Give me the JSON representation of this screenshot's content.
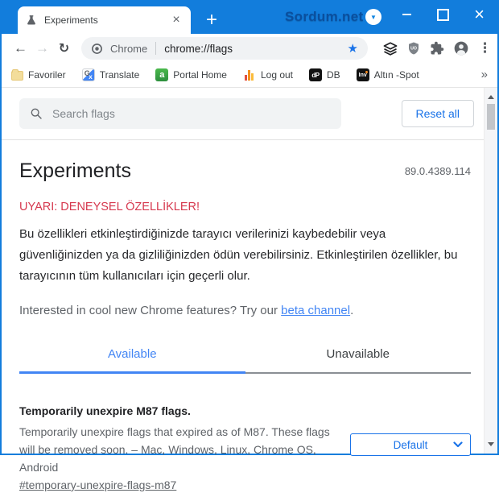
{
  "window": {
    "tab_title": "Experiments",
    "watermark": "Sordum.net"
  },
  "toolbar": {
    "site_label": "Chrome",
    "url": "chrome://flags"
  },
  "bookmarks": {
    "items": [
      {
        "label": "Favoriler",
        "icon": "folder-icon"
      },
      {
        "label": "Translate",
        "icon": "translate-icon"
      },
      {
        "label": "Portal Home",
        "icon": "portal-icon"
      },
      {
        "label": "Log out",
        "icon": "logout-bars-icon"
      },
      {
        "label": "DB",
        "icon": "db-icon"
      },
      {
        "label": "Altın -Spot",
        "icon": "investing-icon"
      }
    ]
  },
  "page": {
    "search_placeholder": "Search flags",
    "reset_button": "Reset all",
    "title": "Experiments",
    "version": "89.0.4389.114",
    "warning": "UYARI: DENEYSEL ÖZELLİKLER!",
    "intro": "Bu özellikleri etkinleştirdiğinizde tarayıcı verilerinizi kaybedebilir veya güvenliğinizden ya da gizliliğinizden ödün verebilirsiniz. Etkinleştirilen özellikler, bu tarayıcının tüm kullanıcıları için geçerli olur.",
    "promo_prefix": "Interested in cool new Chrome features? Try our ",
    "promo_link": "beta channel",
    "promo_suffix": ".",
    "tabs": [
      {
        "label": "Available",
        "active": true
      },
      {
        "label": "Unavailable",
        "active": false
      }
    ],
    "flag": {
      "name": "Temporarily unexpire M87 flags.",
      "description": "Temporarily unexpire flags that expired as of M87. These flags will be removed soon. – Mac, Windows, Linux, Chrome OS, Android",
      "permalink": "#temporary-unexpire-flags-m87",
      "selected_option": "Default"
    }
  },
  "colors": {
    "titlebar_blue": "#127ddc",
    "accent_blue": "#1a73e8",
    "link_blue": "#4285f4",
    "warning_red": "#d6384e",
    "text_dark": "#202124",
    "text_gray": "#5f6368",
    "input_bg": "#f1f3f4"
  },
  "icons": {
    "search": "magnifier",
    "bookmark_star": "★",
    "back": "←",
    "forward": "→",
    "reload": "↻",
    "menu": "⋮",
    "bookmarks_overflow": "»",
    "select_chevron": "v",
    "watermark_arrow": "▼",
    "close": "×",
    "new_tab": "+"
  }
}
